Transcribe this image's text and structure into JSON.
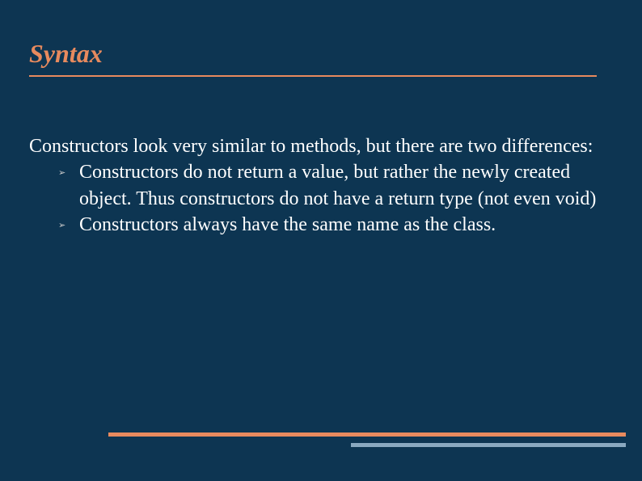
{
  "slide": {
    "title": "Syntax",
    "intro": "Constructors look very similar to methods, but there are two differences:",
    "bullets": [
      "Constructors do not return a value, but rather the newly created object. Thus constructors do not have a return type (not even void)",
      "Constructors always have the same name as the class."
    ]
  }
}
